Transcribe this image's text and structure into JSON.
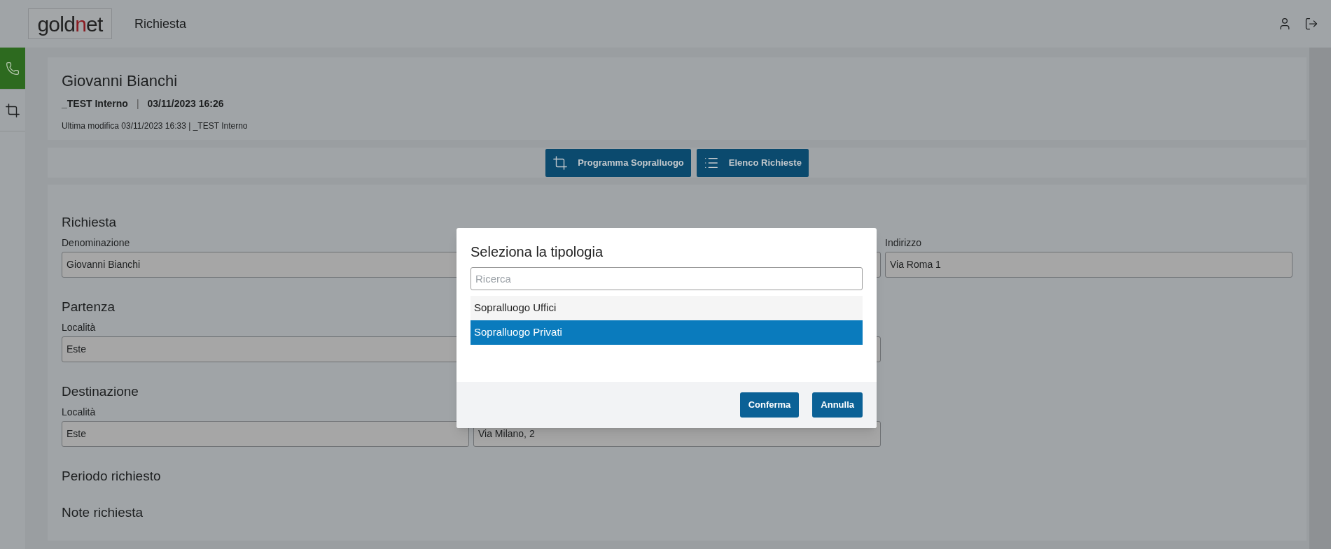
{
  "header": {
    "logo": [
      {
        "text": "gold",
        "accent": false
      },
      {
        "text": "n",
        "accent": true
      },
      {
        "text": "et",
        "accent": false
      }
    ],
    "title": "Richiesta"
  },
  "sidebar": {
    "items": [
      {
        "kind": "phone",
        "selected": true
      },
      {
        "kind": "crop",
        "selected": false
      }
    ]
  },
  "record": {
    "name": "Giovanni Bianchi",
    "owner": "_TEST Interno",
    "separator": "|",
    "date": "03/11/2023 16:26",
    "last_modified": "Ultima modifica 03/11/2023 16:33 | _TEST Interno"
  },
  "actions": [
    {
      "kind": "crop",
      "label": "Programma Sopralluogo"
    },
    {
      "kind": "list",
      "label": "Elenco Richieste"
    }
  ],
  "sections": [
    {
      "title": "Richiesta",
      "fields": [
        {
          "kind": "input",
          "label": "Denominazione",
          "value": "Giovanni Bianchi"
        },
        {
          "kind": "input"
        },
        {
          "kind": "input",
          "label": "Indirizzo",
          "value": "Via Roma 1"
        }
      ]
    },
    {
      "title": "Partenza",
      "fields": [
        {
          "kind": "input",
          "label": "Località",
          "value": "Este"
        },
        {
          "kind": "input"
        }
      ]
    },
    {
      "title": "Destinazione",
      "fields": [
        {
          "kind": "input",
          "label": "Località",
          "value": "Este"
        },
        {
          "kind": "input",
          "value": "Via Milano, 2"
        }
      ]
    },
    {
      "title": "Periodo richiesto"
    },
    {
      "title": "Note richiesta"
    }
  ],
  "dialog": {
    "title": "Seleziona la tipologia",
    "search": {
      "placeholder": "Ricerca"
    },
    "options": [
      {
        "label": "Sopralluogo Uffici",
        "selected": false
      },
      {
        "label": "Sopralluogo Privati",
        "selected": true
      }
    ],
    "buttons": [
      "Conferma",
      "Annulla"
    ]
  }
}
